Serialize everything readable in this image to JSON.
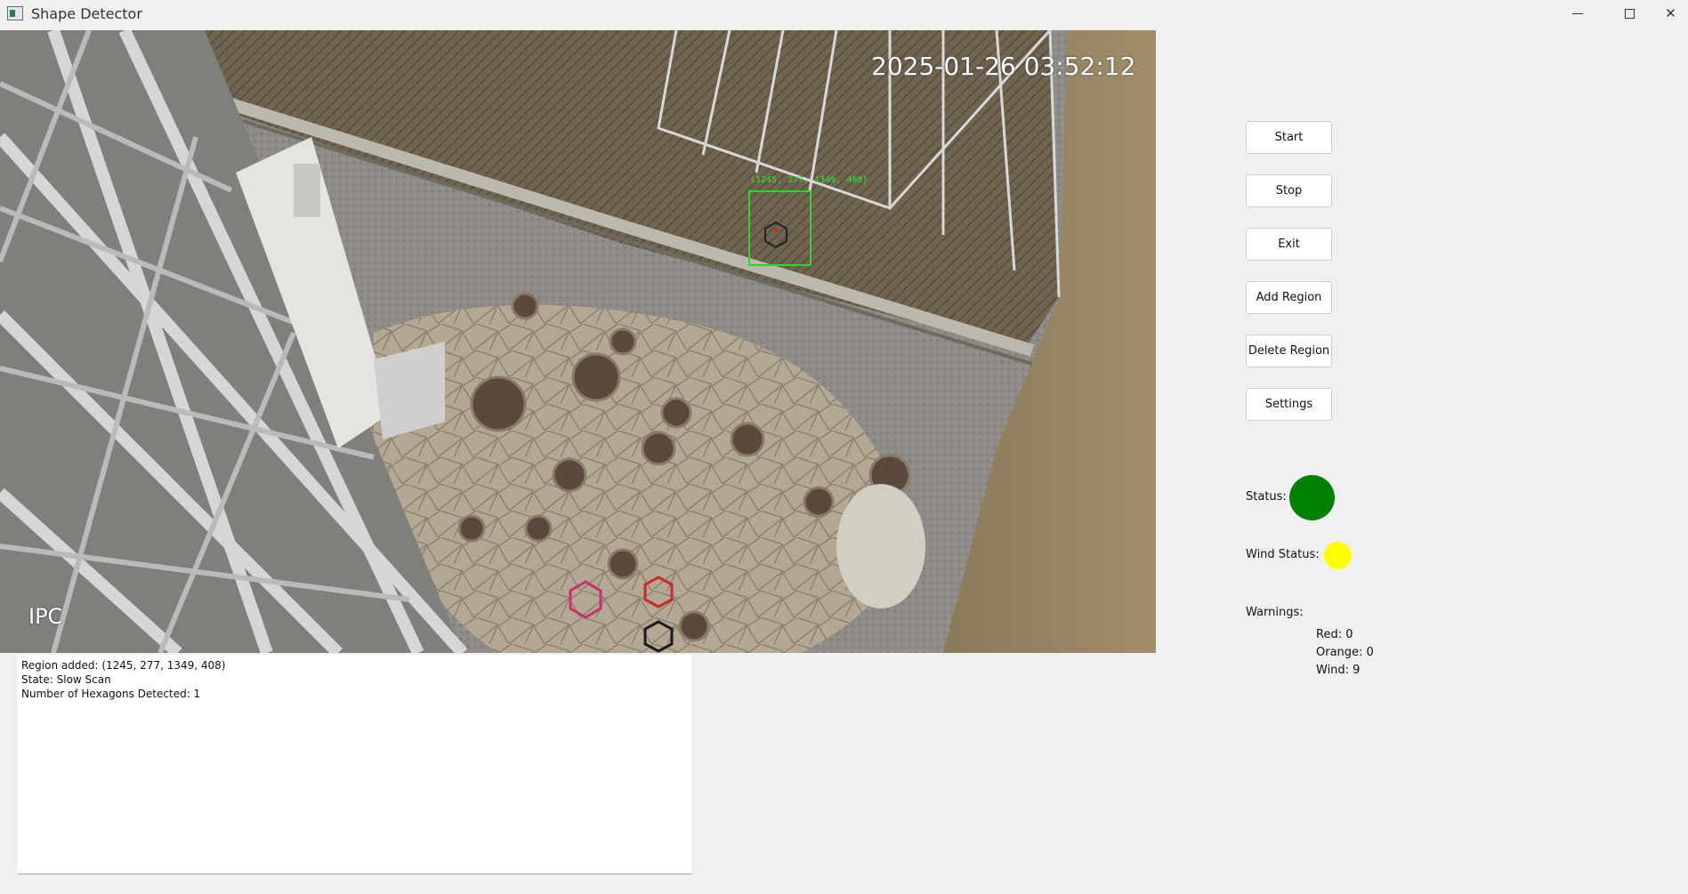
{
  "window": {
    "title": "Shape Detector",
    "icon": "app-window-icon",
    "controls": {
      "minimize_icon": "minimize-icon",
      "maximize_icon": "maximize-icon",
      "close_glyph": "✕"
    }
  },
  "video": {
    "timestamp": "2025-01-26 03:52:12",
    "camera_label": "IPC",
    "region_box_label": "(1245, 277, 1349, 408)",
    "region_box_color": "#1ee01e"
  },
  "log": {
    "lines": [
      "Region added: (1245, 277, 1349, 408)",
      "State: Slow Scan",
      "Number of Hexagons Detected: 1"
    ]
  },
  "controls": {
    "start": "Start",
    "stop": "Stop",
    "exit": "Exit",
    "add_region": "Add Region",
    "delete_region": "Delete Region",
    "settings": "Settings"
  },
  "status": {
    "label": "Status:",
    "color": "#008000"
  },
  "wind_status": {
    "label": "Wind Status:",
    "color": "#ffff00"
  },
  "warnings": {
    "label": "Warnings:",
    "red": "Red: 0",
    "orange": "Orange: 0",
    "wind": "Wind: 9"
  }
}
